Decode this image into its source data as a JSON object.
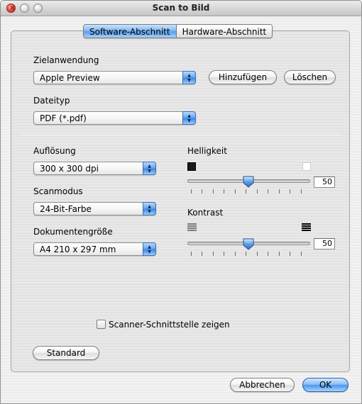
{
  "window": {
    "title": "Scan to Bild"
  },
  "tabs": [
    {
      "label": "Software-Abschnitt",
      "active": true
    },
    {
      "label": "Hardware-Abschnitt",
      "active": false
    }
  ],
  "target_app": {
    "label": "Zielanwendung",
    "value": "Apple Preview",
    "add_label": "Hinzufügen",
    "delete_label": "Löschen"
  },
  "file_type": {
    "label": "Dateityp",
    "value": "PDF (*.pdf)"
  },
  "resolution": {
    "label": "Auflösung",
    "value": "300 x 300 dpi"
  },
  "scan_mode": {
    "label": "Scanmodus",
    "value": "24-Bit-Farbe"
  },
  "document_size": {
    "label": "Dokumentengröße",
    "value": "A4  210 x 297 mm"
  },
  "brightness": {
    "label": "Helligkeit",
    "value": "50",
    "level": 0.5
  },
  "contrast": {
    "label": "Kontrast",
    "value": "50",
    "level": 0.5
  },
  "scanner_interface": {
    "label": "Scanner-Schnittstelle zeigen",
    "checked": false
  },
  "buttons": {
    "standard": "Standard",
    "cancel": "Abbrechen",
    "ok": "OK"
  },
  "colors": {
    "accent": "#5b9ee8"
  }
}
